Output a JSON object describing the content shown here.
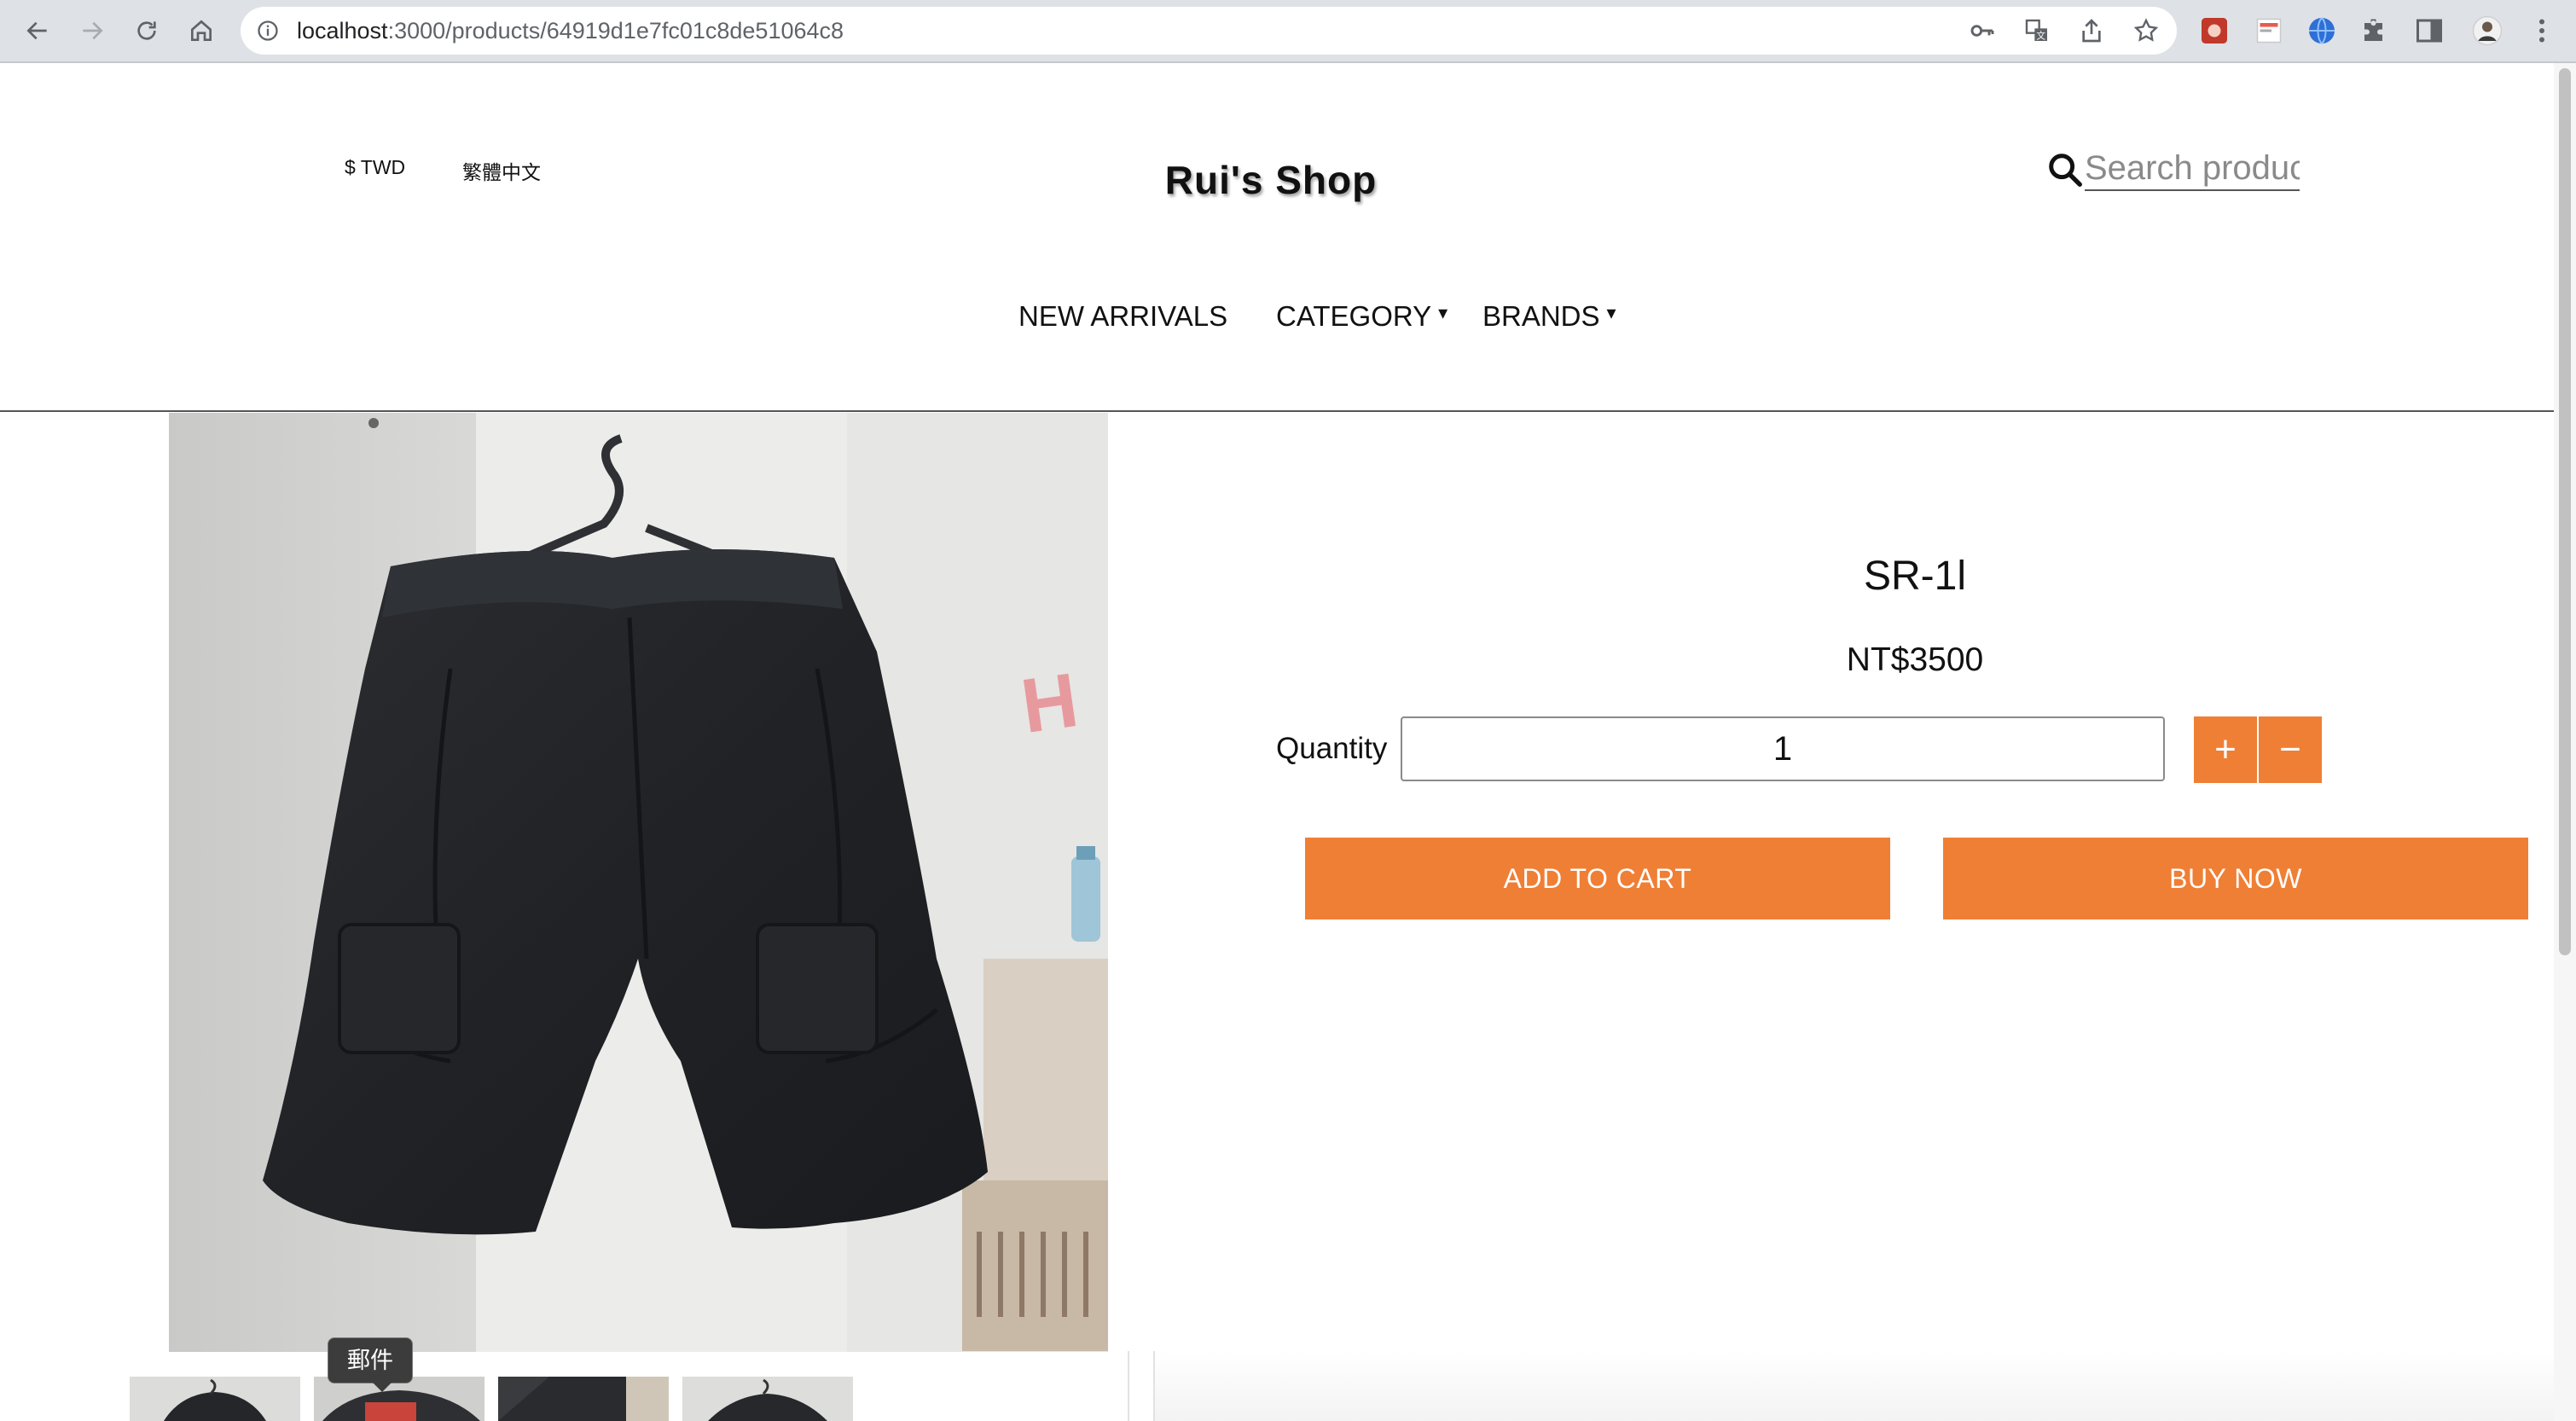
{
  "browser": {
    "url_host": "localhost",
    "url_path": ":3000/products/64919d1e7fc01c8de51064c8",
    "icons": [
      "back-icon",
      "forward-icon",
      "reload-icon",
      "home-icon",
      "info-icon",
      "key-icon",
      "translate-icon",
      "share-icon",
      "bookmark-star-icon",
      "extension-icon",
      "puzzle-icon",
      "side-panel-icon",
      "profile-avatar",
      "menu-dots-icon"
    ]
  },
  "header": {
    "currency": "$ TWD",
    "language": "繁體中文",
    "logo": "Rui's Shop",
    "search_placeholder": "Search products"
  },
  "nav": {
    "new_arrivals": "NEW ARRIVALS",
    "category": "CATEGORY",
    "brands": "BRANDS",
    "caret": "▾"
  },
  "product": {
    "title": "SR-1l",
    "price": "NT$3500",
    "quantity_label": "Quantity",
    "quantity_value": "1",
    "plus": "+",
    "minus": "−",
    "add_to_cart": "ADD TO CART",
    "buy_now": "BUY NOW"
  },
  "thumbnails": {
    "tooltip": "郵件",
    "count": 4
  },
  "colors": {
    "accent": "#ef7f35",
    "chrome_bg": "#dee1e6"
  }
}
